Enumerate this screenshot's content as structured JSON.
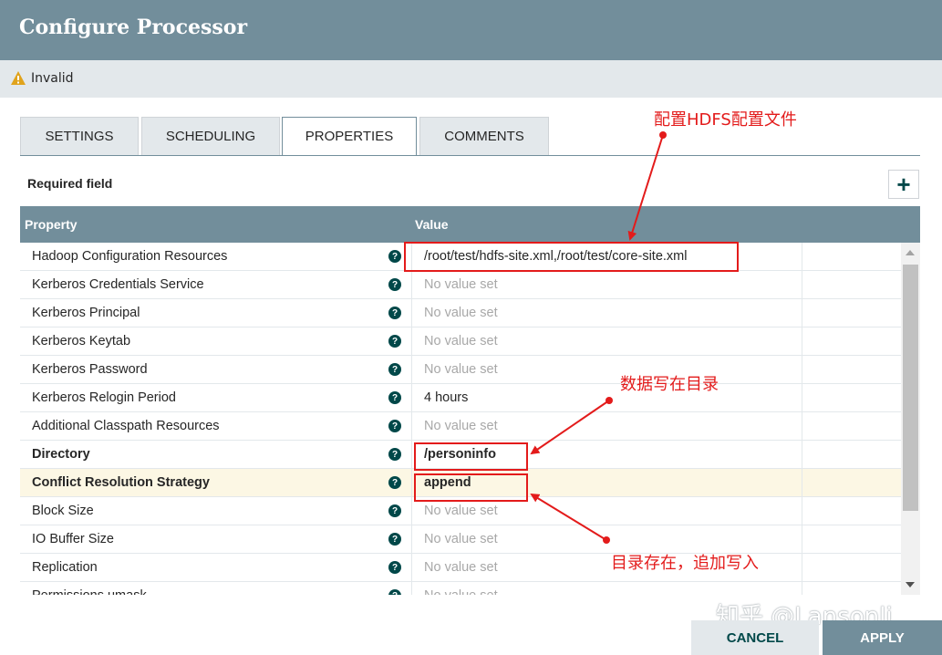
{
  "window": {
    "title": "Configure Processor"
  },
  "status": {
    "text": "Invalid",
    "icon": "warning-icon",
    "color": "#e0a31c"
  },
  "tabs": [
    {
      "label": "SETTINGS",
      "active": false
    },
    {
      "label": "SCHEDULING",
      "active": false
    },
    {
      "label": "PROPERTIES",
      "active": true
    },
    {
      "label": "COMMENTS",
      "active": false
    }
  ],
  "required_field_label": "Required field",
  "add_button": {
    "label": "+",
    "icon": "plus-icon"
  },
  "table": {
    "headers": {
      "property": "Property",
      "value": "Value"
    },
    "rows": [
      {
        "name": "Hadoop Configuration Resources",
        "value": "/root/test/hdfs-site.xml,/root/test/core-site.xml",
        "required": false,
        "empty": false
      },
      {
        "name": "Kerberos Credentials Service",
        "value": "No value set",
        "required": false,
        "empty": true
      },
      {
        "name": "Kerberos Principal",
        "value": "No value set",
        "required": false,
        "empty": true
      },
      {
        "name": "Kerberos Keytab",
        "value": "No value set",
        "required": false,
        "empty": true
      },
      {
        "name": "Kerberos Password",
        "value": "No value set",
        "required": false,
        "empty": true
      },
      {
        "name": "Kerberos Relogin Period",
        "value": "4 hours",
        "required": false,
        "empty": false
      },
      {
        "name": "Additional Classpath Resources",
        "value": "No value set",
        "required": false,
        "empty": true
      },
      {
        "name": "Directory",
        "value": "/personinfo",
        "required": true,
        "empty": false
      },
      {
        "name": "Conflict Resolution Strategy",
        "value": "append",
        "required": true,
        "empty": false,
        "highlighted": true
      },
      {
        "name": "Block Size",
        "value": "No value set",
        "required": false,
        "empty": true
      },
      {
        "name": "IO Buffer Size",
        "value": "No value set",
        "required": false,
        "empty": true
      },
      {
        "name": "Replication",
        "value": "No value set",
        "required": false,
        "empty": true
      },
      {
        "name": "Permissions umask",
        "value": "No value set",
        "required": false,
        "empty": true
      }
    ],
    "help_icon": "help-icon"
  },
  "annotations": {
    "hdfs_config": "配置HDFS配置文件",
    "data_dir": "数据写在目录",
    "append": "目录存在，追加写入",
    "color": "#e31b1b"
  },
  "watermark": "知乎 @Lansonli",
  "footer": {
    "cancel_label": "CANCEL",
    "apply_label": "APPLY"
  },
  "colors": {
    "header": "#728e9b",
    "accent": "#004849",
    "status_bar": "#e3e8eb"
  }
}
